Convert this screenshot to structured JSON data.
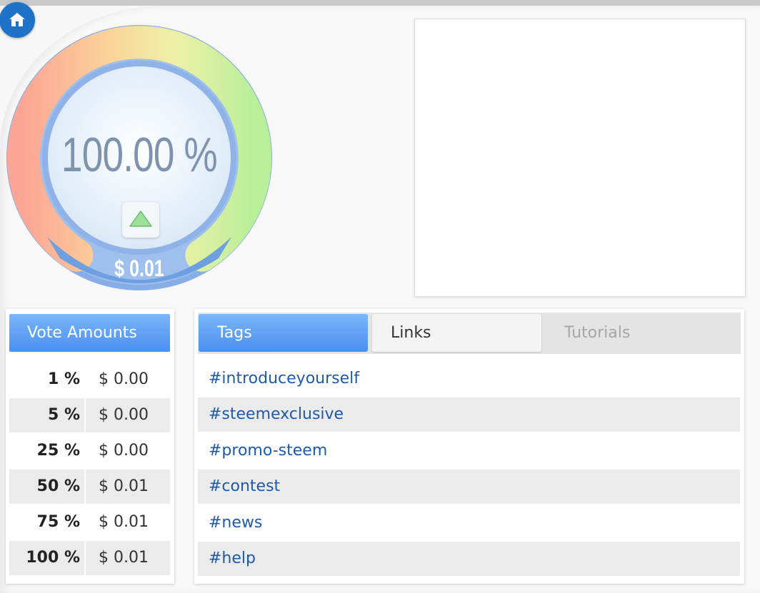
{
  "gauge": {
    "percent_text": "100.00 %",
    "amount_text": "$ 0.01",
    "level": 1.0
  },
  "vote_amounts": {
    "title": "Vote Amounts",
    "rows": [
      {
        "percent": "1 %",
        "amount": "$ 0.00"
      },
      {
        "percent": "5 %",
        "amount": "$ 0.00"
      },
      {
        "percent": "25 %",
        "amount": "$ 0.00"
      },
      {
        "percent": "50 %",
        "amount": "$ 0.01"
      },
      {
        "percent": "75 %",
        "amount": "$ 0.01"
      },
      {
        "percent": "100 %",
        "amount": "$ 0.01"
      }
    ]
  },
  "tabs": {
    "tags_label": "Tags",
    "links_label": "Links",
    "tutorials_label": "Tutorials",
    "active": "Tags"
  },
  "tags": [
    "#introduceyourself",
    "#steemexclusive",
    "#promo-steem",
    "#contest",
    "#news",
    "#help"
  ],
  "icons": {
    "home": "home-icon",
    "upvote": "triangle-up-icon"
  },
  "colors": {
    "accent_blue": "#4b8ff1",
    "tag_link": "#1f5aa8",
    "gauge_ring": "#6e9fe0"
  }
}
